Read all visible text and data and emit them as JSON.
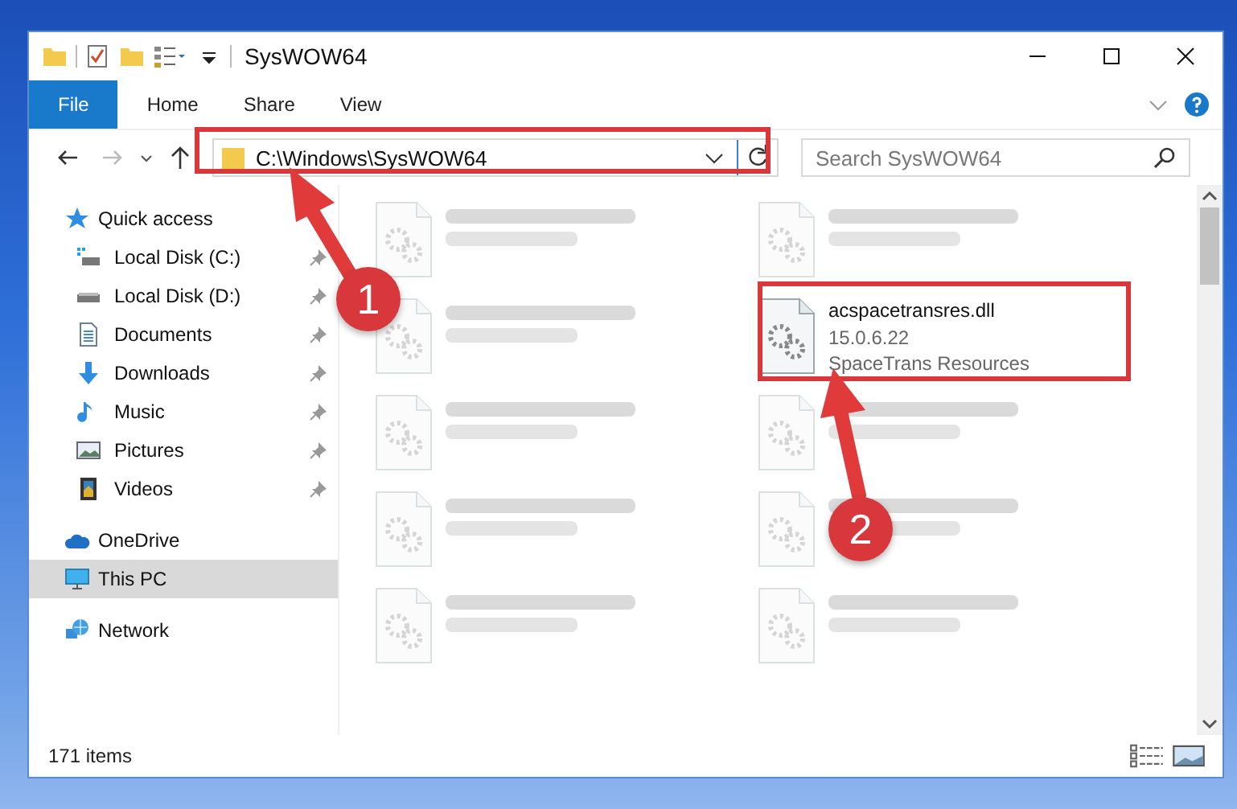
{
  "window": {
    "title": "SysWOW64"
  },
  "ribbon": {
    "tabs": [
      {
        "label": "File",
        "kind": "file",
        "selected": false
      },
      {
        "label": "Home",
        "kind": "tab",
        "selected": false
      },
      {
        "label": "Share",
        "kind": "tab",
        "selected": false
      },
      {
        "label": "View",
        "kind": "tab",
        "selected": false
      }
    ]
  },
  "address_bar": {
    "path": "C:\\Windows\\SysWOW64"
  },
  "search": {
    "placeholder": "Search SysWOW64"
  },
  "sidebar": {
    "items": [
      {
        "label": "Quick access",
        "kind": "quick",
        "selected": false,
        "children": [
          {
            "label": "Local Disk (C:)",
            "kind": "disk-c",
            "pinned": true
          },
          {
            "label": "Local Disk (D:)",
            "kind": "disk",
            "pinned": true
          },
          {
            "label": "Documents",
            "kind": "documents",
            "pinned": true
          },
          {
            "label": "Downloads",
            "kind": "downloads",
            "pinned": true
          },
          {
            "label": "Music",
            "kind": "music",
            "pinned": true
          },
          {
            "label": "Pictures",
            "kind": "pictures",
            "pinned": true
          },
          {
            "label": "Videos",
            "kind": "videos",
            "pinned": true
          }
        ]
      },
      {
        "label": "OneDrive",
        "kind": "cloud",
        "selected": false
      },
      {
        "label": "This PC",
        "kind": "pc",
        "selected": true
      },
      {
        "label": "Network",
        "kind": "network",
        "selected": false
      }
    ]
  },
  "files": [
    {
      "blurred": true
    },
    {
      "blurred": true
    },
    {
      "blurred": true
    },
    {
      "name": "acspacetransres.dll",
      "details": [
        "15.0.6.22",
        "SpaceTrans Resources"
      ],
      "blurred": false
    },
    {
      "blurred": true
    },
    {
      "blurred": true
    },
    {
      "blurred": true
    },
    {
      "blurred": true
    },
    {
      "blurred": true
    },
    {
      "blurred": true
    }
  ],
  "status_bar": {
    "item_count": "171 items"
  },
  "annotations": [
    {
      "number": "1"
    },
    {
      "number": "2"
    }
  ]
}
